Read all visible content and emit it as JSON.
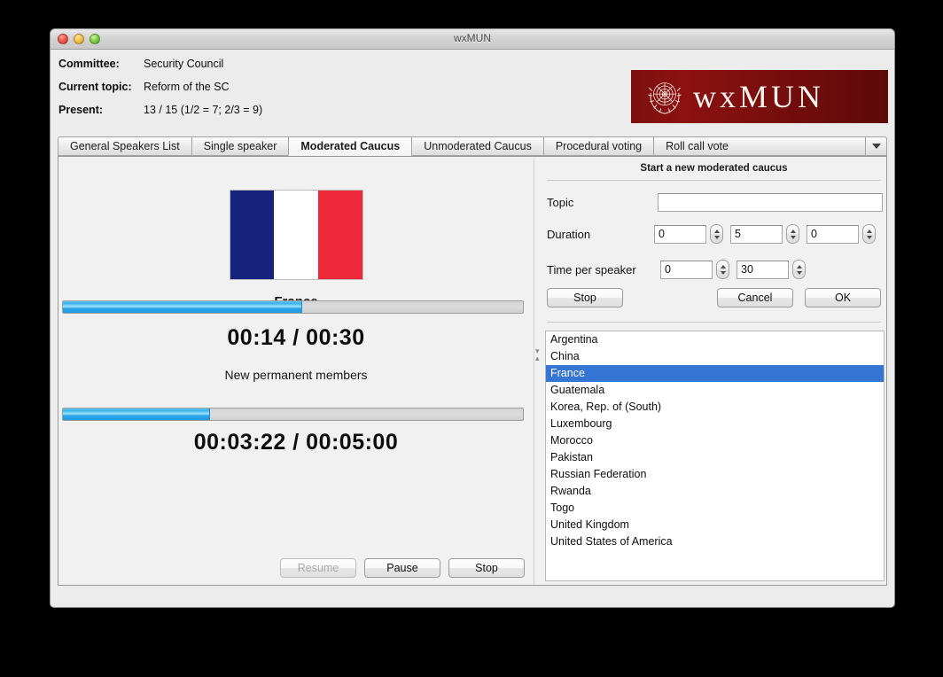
{
  "window": {
    "title": "wxMUN",
    "traffic_lights": [
      "close-button",
      "minimize-button",
      "maximize-button"
    ]
  },
  "header": {
    "rows": [
      {
        "label": "Committee:",
        "value": "Security Council"
      },
      {
        "label": "Current topic:",
        "value": "Reform of the SC"
      },
      {
        "label": "Present:",
        "value": "13 / 15  (1/2 = 7; 2/3 = 9)"
      }
    ],
    "logo_text": "wxMUN",
    "logo_background": "#7c0f0f",
    "logo_emblem": "un-emblem-icon"
  },
  "tabs": {
    "items": [
      {
        "label": "General Speakers List",
        "active": false
      },
      {
        "label": "Single speaker",
        "active": false
      },
      {
        "label": "Moderated Caucus",
        "active": true
      },
      {
        "label": "Unmoderated Caucus",
        "active": false
      },
      {
        "label": "Procedural voting",
        "active": false
      },
      {
        "label": "Roll call vote",
        "active": false
      }
    ],
    "overflow_icon": "chevron-down-icon"
  },
  "left_pane": {
    "country": "France",
    "flag": {
      "name": "france-flag",
      "bands": [
        "#16237c",
        "#ffffff",
        "#ed2939"
      ]
    },
    "speaker_progress_percent": 52,
    "speaker_timer": "00:14  /  00:30",
    "caucus_topic": "New permanent members",
    "caucus_progress_percent": 32,
    "caucus_timer": "00:03:22  /  00:05:00",
    "buttons": [
      {
        "label": "Resume",
        "disabled": true
      },
      {
        "label": "Pause",
        "disabled": false
      },
      {
        "label": "Stop",
        "disabled": false
      }
    ]
  },
  "right_pane": {
    "form_title": "Start a new moderated caucus",
    "topic_label": "Topic",
    "topic_value": "",
    "topic_placeholder": "",
    "duration_label": "Duration",
    "duration_values": [
      "0",
      "5",
      "0"
    ],
    "time_per_speaker_label": "Time per speaker",
    "time_per_speaker_values": [
      "0",
      "30"
    ],
    "buttons": {
      "stop": "Stop",
      "cancel": "Cancel",
      "ok": "OK"
    },
    "selection_color": "#3575d3",
    "countries": [
      {
        "name": "Argentina",
        "selected": false
      },
      {
        "name": "China",
        "selected": false
      },
      {
        "name": "France",
        "selected": true
      },
      {
        "name": "Guatemala",
        "selected": false
      },
      {
        "name": "Korea, Rep. of (South)",
        "selected": false
      },
      {
        "name": "Luxembourg",
        "selected": false
      },
      {
        "name": "Morocco",
        "selected": false
      },
      {
        "name": "Pakistan",
        "selected": false
      },
      {
        "name": "Russian Federation",
        "selected": false
      },
      {
        "name": "Rwanda",
        "selected": false
      },
      {
        "name": "Togo",
        "selected": false
      },
      {
        "name": "United Kingdom",
        "selected": false
      },
      {
        "name": "United States of America",
        "selected": false
      }
    ]
  }
}
